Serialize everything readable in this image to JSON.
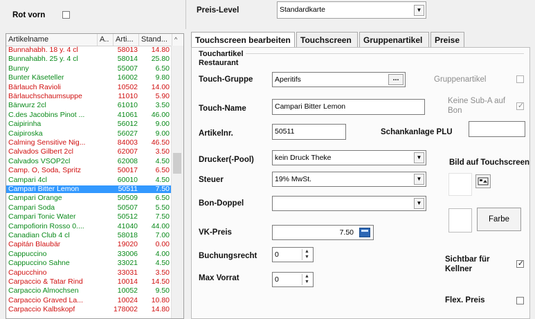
{
  "left_header": {
    "rot_vorn_label": "Rot vorn",
    "rot_vorn_checked": false
  },
  "list": {
    "columns": [
      "Artikelname",
      "A..",
      "Arti...",
      "Stand...",
      "^"
    ],
    "rows": [
      {
        "name": "Bunnahabh. 18 y. 4 cl",
        "nr": "58013",
        "price": "14.80",
        "color": "#d01010"
      },
      {
        "name": "Bunnahabh. 25 y. 4 cl",
        "nr": "58014",
        "price": "25.80",
        "color": "#0a8a1a"
      },
      {
        "name": "Bunny",
        "nr": "55007",
        "price": "6.50",
        "color": "#0a8a1a"
      },
      {
        "name": "Bunter Käseteller",
        "nr": "16002",
        "price": "9.80",
        "color": "#0a8a1a"
      },
      {
        "name": "Bärlauch Ravioli",
        "nr": "10502",
        "price": "14.00",
        "color": "#d01010"
      },
      {
        "name": "Bärlauchschaumsuppe",
        "nr": "11010",
        "price": "5.90",
        "color": "#d01010"
      },
      {
        "name": "Bärwurz 2cl",
        "nr": "61010",
        "price": "3.50",
        "color": "#0a8a1a"
      },
      {
        "name": "C.des Jacobins Pinot ...",
        "nr": "41061",
        "price": "46.00",
        "color": "#0a8a1a"
      },
      {
        "name": "Caipirinha",
        "nr": "56012",
        "price": "9.00",
        "color": "#0a8a1a"
      },
      {
        "name": "Caipiroska",
        "nr": "56027",
        "price": "9.00",
        "color": "#0a8a1a"
      },
      {
        "name": "Calming Sensitive Nig...",
        "nr": "84003",
        "price": "46.50",
        "color": "#d01010"
      },
      {
        "name": "Calvados Gilbert 2cl",
        "nr": "62007",
        "price": "3.50",
        "color": "#d01010"
      },
      {
        "name": "Calvados VSOP2cl",
        "nr": "62008",
        "price": "4.50",
        "color": "#0a8a1a"
      },
      {
        "name": "Camp. O, Soda, Spritz",
        "nr": "50017",
        "price": "6.50",
        "color": "#d01010"
      },
      {
        "name": "Campari 4cl",
        "nr": "60010",
        "price": "4.50",
        "color": "#0a8a1a"
      },
      {
        "name": "Campari Bitter Lemon",
        "nr": "50511",
        "price": "7.50",
        "color": "#0a8a1a",
        "selected": true
      },
      {
        "name": "Campari Orange",
        "nr": "50509",
        "price": "6.50",
        "color": "#0a8a1a"
      },
      {
        "name": "Campari Soda",
        "nr": "50507",
        "price": "5.50",
        "color": "#0a8a1a"
      },
      {
        "name": "Campari Tonic Water",
        "nr": "50512",
        "price": "7.50",
        "color": "#0a8a1a"
      },
      {
        "name": "Campofiorin Rosso 0....",
        "nr": "41040",
        "price": "44.00",
        "color": "#0a8a1a"
      },
      {
        "name": "Canadian Club 4 cl",
        "nr": "58018",
        "price": "7.00",
        "color": "#0a8a1a"
      },
      {
        "name": "Capitán Blaubär",
        "nr": "19020",
        "price": "0.00",
        "color": "#d01010"
      },
      {
        "name": "Cappuccino",
        "nr": "33006",
        "price": "4.00",
        "color": "#0a8a1a"
      },
      {
        "name": "Cappuccino Sahne",
        "nr": "33021",
        "price": "4.50",
        "color": "#0a8a1a"
      },
      {
        "name": "Capucchino",
        "nr": "33031",
        "price": "3.50",
        "color": "#d01010"
      },
      {
        "name": "Carpaccio & Tatar Rind",
        "nr": "10014",
        "price": "14.50",
        "color": "#d01010"
      },
      {
        "name": "Carpaccio Almochsen",
        "nr": "10052",
        "price": "9.50",
        "color": "#0a8a1a"
      },
      {
        "name": "Carpaccio Graved La...",
        "nr": "10024",
        "price": "10.80",
        "color": "#d01010"
      },
      {
        "name": "Carpaccio Kalbskopf",
        "nr": "178002",
        "price": "14.80",
        "color": "#d01010"
      }
    ]
  },
  "preis_level": {
    "label": "Preis-Level",
    "value": "Standardkarte"
  },
  "tabs": [
    "Touchscreen bearbeiten",
    "Touchscreen",
    "Gruppenartikel",
    "Preise"
  ],
  "form": {
    "section_title": "Touchartikel",
    "section_subtitle": "Restaurant",
    "touch_gruppe_label": "Touch-Gruppe",
    "touch_gruppe_value": "Aperitifs",
    "touch_gruppe_btn": "...",
    "gruppenartikel_label": "Gruppenartikel",
    "touch_name_label": "Touch-Name",
    "touch_name_value": "Campari Bitter Lemon",
    "keine_sub_label_1": "Keine Sub-A auf",
    "keine_sub_label_2": "Bon",
    "artikelnr_label": "Artikelnr.",
    "artikelnr_value": "50511",
    "schankanlage_label": "Schankanlage PLU",
    "schankanlage_value": "",
    "drucker_label": "Drucker(-Pool)",
    "drucker_value": "kein Druck Theke",
    "bild_label": "Bild auf Touchscreen",
    "steuer_label": "Steuer",
    "steuer_value": "19% MwSt.",
    "bon_doppel_label": "Bon-Doppel",
    "bon_doppel_value": "",
    "farbe_label": "Farbe",
    "vk_preis_label": "VK-Preis",
    "vk_preis_value": "7.50",
    "buchungsrecht_label": "Buchungsrecht",
    "buchungsrecht_value": "0",
    "sichtbar_label_1": "Sichtbar für",
    "sichtbar_label_2": "Kellner",
    "max_vorrat_label": "Max Vorrat",
    "max_vorrat_value": "0",
    "flex_preis_label": "Flex. Preis",
    "checks": {
      "gruppenartikel": false,
      "keine_sub": true,
      "sichtbar": true,
      "flex_preis": false
    }
  },
  "icons": {
    "dropdown": "chevron-down-icon",
    "calculator": "calculator-icon",
    "image": "image-icon",
    "spinner": "spinner-icon"
  }
}
